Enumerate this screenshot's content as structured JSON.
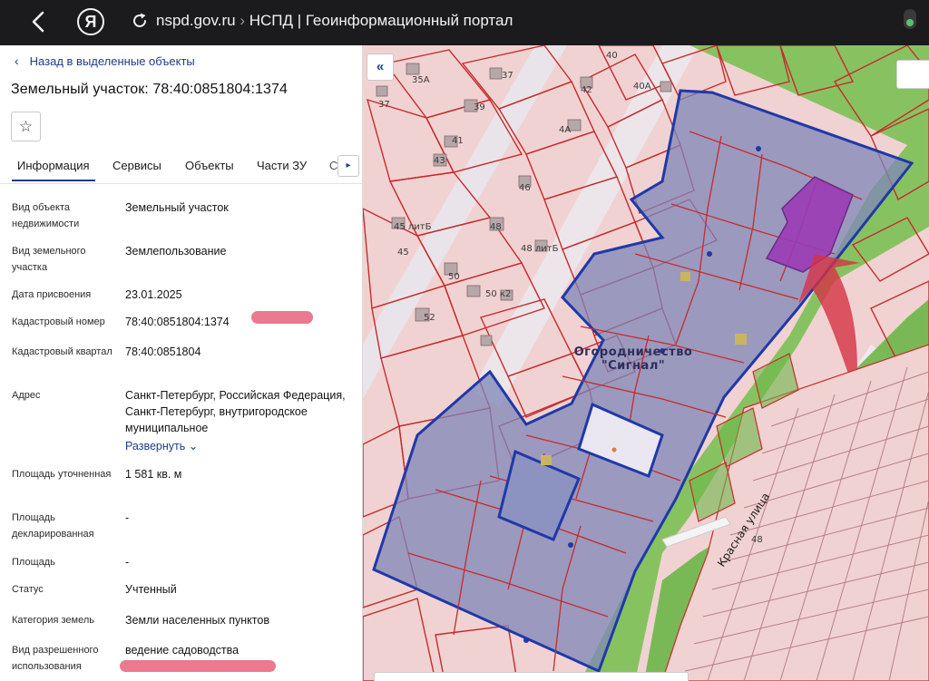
{
  "browser": {
    "domain": "nspd.gov.ru",
    "separator": "›",
    "page_title": "НСПД | Геоинформационный портал",
    "yandex_label": "Я",
    "icons": [
      "back-arrow-icon",
      "yandex-logo-icon",
      "reload-icon"
    ]
  },
  "panel": {
    "back_link": "Назад в выделенные объекты",
    "title": "Земельный участок: 78:40:0851804:1374",
    "favorite_icon": "☆",
    "tabs": [
      {
        "label": "Информация",
        "active": true
      },
      {
        "label": "Сервисы",
        "active": false
      },
      {
        "label": "Объекты",
        "active": false
      },
      {
        "label": "Части ЗУ",
        "active": false
      },
      {
        "label": "С...",
        "active": false
      }
    ],
    "tab_scroll_icon": "▸",
    "properties": [
      {
        "label": "Вид объекта недвижимости",
        "value": "Земельный участок"
      },
      {
        "label": "Вид земельного участка",
        "value": "Землепользование"
      },
      {
        "label": "Дата присвоения",
        "value": "23.01.2025"
      },
      {
        "label": "Кадастровый номер",
        "value": "78:40:0851804:1374"
      },
      {
        "label": "Кадастровый квартал",
        "value": "78:40:0851804"
      },
      {
        "label": "Адрес",
        "value": "Санкт-Петербург, Российская Федерация, Санкт-Петербург, внутригородское муниципальное"
      },
      {
        "label": "Площадь уточненная",
        "value": "1 581 кв. м"
      },
      {
        "label": "Площадь декларированная",
        "value": "-"
      },
      {
        "label": "Площадь",
        "value": "-"
      },
      {
        "label": "Статус",
        "value": "Учтенный"
      },
      {
        "label": "Категория земель",
        "value": "Земли населенных пунктов"
      },
      {
        "label": "Вид разрешенного использования",
        "value": "ведение садоводства"
      }
    ],
    "expand_label": "Развернуть",
    "expand_icon": "⌄"
  },
  "map": {
    "collapse_icon": "«",
    "area_label_line1": "Огородничество",
    "area_label_line2": "\"Сигнал\"",
    "street_label": "Красная улица",
    "house_numbers": [
      "35А",
      "37",
      "37",
      "39",
      "40",
      "40А",
      "41",
      "42",
      "43",
      "4А",
      "46",
      "45 литБ",
      "45",
      "48",
      "48 литБ",
      "50",
      "50 к2",
      "52",
      "48"
    ],
    "colors": {
      "parcel_fill": "#f1d2d2",
      "parcel_border": "#c62b2b",
      "selection_border": "#1f39a8",
      "selection_fill": "#7f86b8",
      "greenery": "#6fbf4f",
      "highlight": "#9b3bb5",
      "arrow": "#d63245"
    }
  }
}
